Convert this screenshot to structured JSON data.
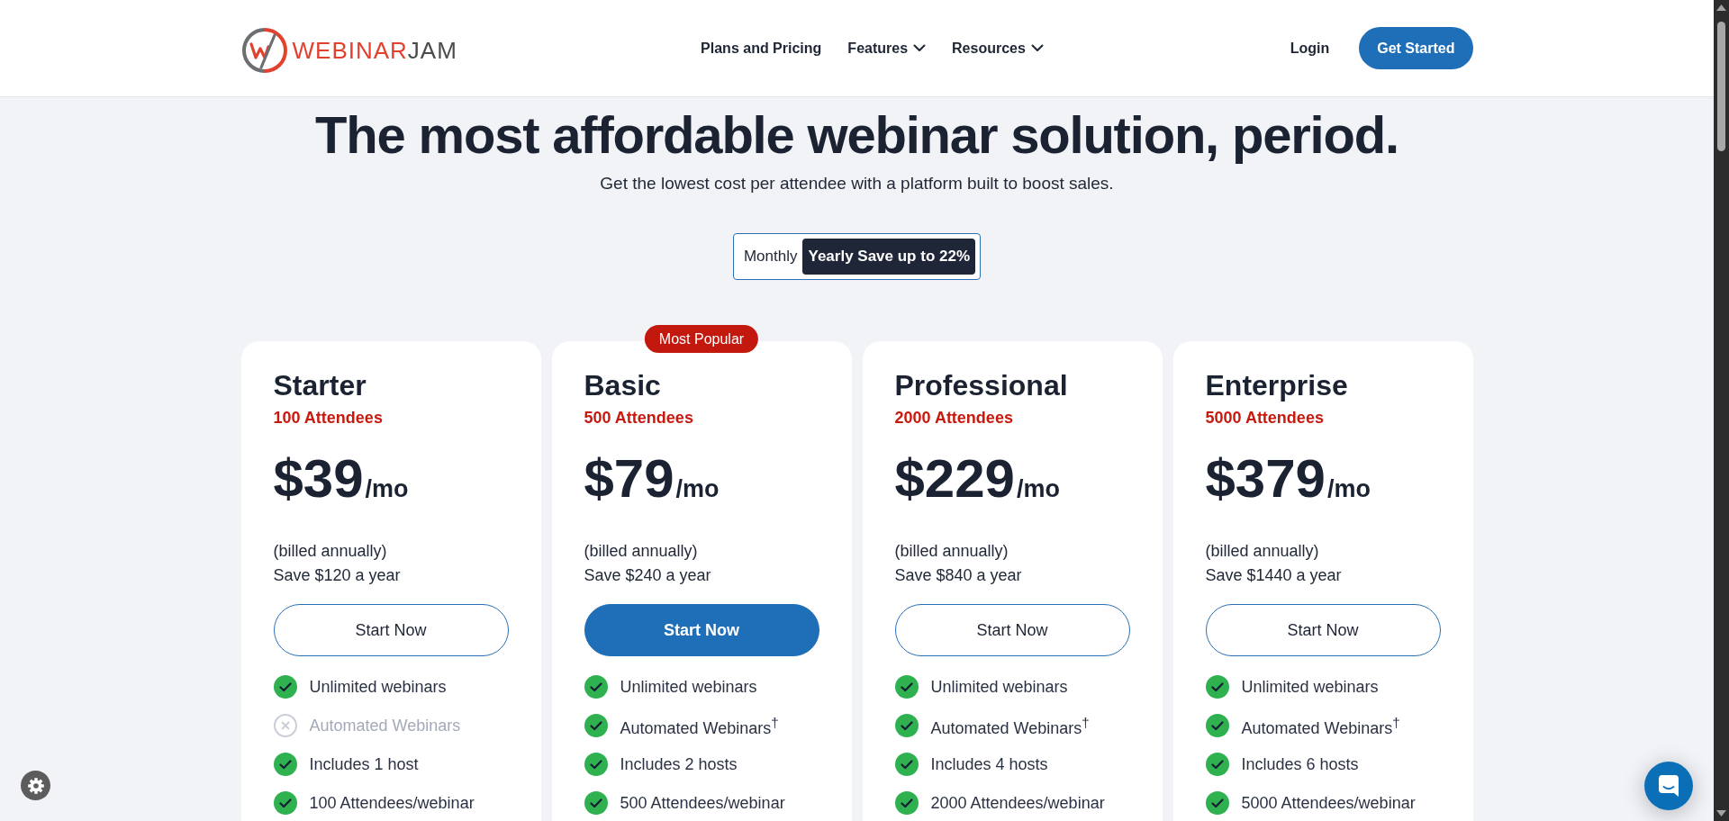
{
  "header": {
    "logo": [
      "WEBINAR",
      "JAM"
    ],
    "nav": [
      {
        "label": "Plans and Pricing",
        "kind": "link"
      },
      {
        "label": "Features",
        "kind": "dropdown"
      },
      {
        "label": "Resources",
        "kind": "dropdown"
      }
    ],
    "login": "Login",
    "cta": "Get Started"
  },
  "hero": {
    "title": "The most affordable webinar solution, period.",
    "subtitle": "Get the lowest cost per attendee with a platform built to boost sales."
  },
  "billing_toggle": [
    {
      "label": "Monthly",
      "selected": false
    },
    {
      "label": "Yearly Save up to 22%",
      "selected": true
    }
  ],
  "plans": [
    {
      "name": "Starter",
      "attendees": "100 Attendees",
      "price": "$39",
      "period": "/mo",
      "billing": "(billed annually)",
      "savings": "Save $120 a year",
      "button": "Start Now",
      "featured": false,
      "features": [
        {
          "text": "Unlimited webinars",
          "included": true
        },
        {
          "text": "Automated Webinars",
          "included": false
        },
        {
          "text": "Includes 1 host",
          "included": true
        },
        {
          "text": "100 Attendees/webinar",
          "included": true
        }
      ]
    },
    {
      "name": "Basic",
      "badge": "Most Popular",
      "attendees": "500 Attendees",
      "price": "$79",
      "period": "/mo",
      "billing": "(billed annually)",
      "savings": "Save $240 a year",
      "button": "Start Now",
      "featured": true,
      "features": [
        {
          "text": "Unlimited webinars",
          "included": true
        },
        {
          "text": "Automated Webinars$^{†}$",
          "included": true
        },
        {
          "text": "Includes 2 hosts",
          "included": true
        },
        {
          "text": "500 Attendees/webinar",
          "included": true
        }
      ]
    },
    {
      "name": "Professional",
      "attendees": "2000 Attendees",
      "price": "$229",
      "period": "/mo",
      "billing": "(billed annually)",
      "savings": "Save $840 a year",
      "button": "Start Now",
      "featured": false,
      "features": [
        {
          "text": "Unlimited webinars",
          "included": true
        },
        {
          "text": "Automated Webinars$^{†}$",
          "included": true
        },
        {
          "text": "Includes 4 hosts",
          "included": true
        },
        {
          "text": "2000 Attendees/webinar",
          "included": true
        }
      ]
    },
    {
      "name": "Enterprise",
      "attendees": "5000 Attendees",
      "price": "$379",
      "period": "/mo",
      "billing": "(billed annually)",
      "savings": "Save $1440 a year",
      "button": "Start Now",
      "featured": false,
      "features": [
        {
          "text": "Unlimited webinars",
          "included": true
        },
        {
          "text": "Automated Webinars$^{†}$",
          "included": true
        },
        {
          "text": "Includes 6 hosts",
          "included": true
        },
        {
          "text": "5000 Attendees/webinar",
          "included": true
        }
      ]
    }
  ]
}
